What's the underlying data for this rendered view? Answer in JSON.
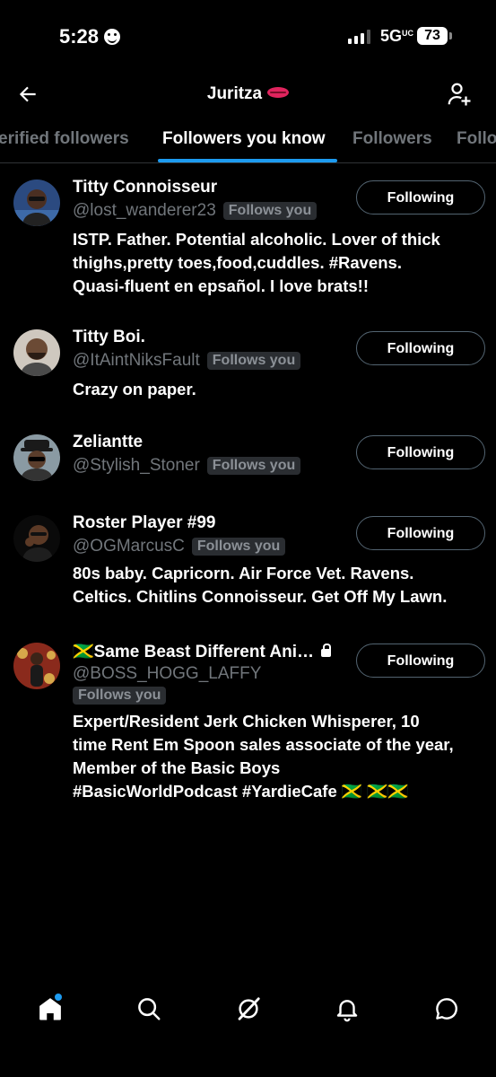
{
  "status_bar": {
    "time": "5:28",
    "network": "5G",
    "network_sup": "UC",
    "battery": "73"
  },
  "header": {
    "title": "Juritza"
  },
  "tabs": [
    {
      "label": "erified followers"
    },
    {
      "label": "Followers you know"
    },
    {
      "label": "Followers"
    },
    {
      "label": "Follo"
    }
  ],
  "users": [
    {
      "name": "Titty Connoisseur",
      "handle": "@lost_wanderer23",
      "badge": "Follows you",
      "button": "Following",
      "bio_lines": [
        "ISTP. Father. Potential alcoholic. Lover of thick",
        "thighs,pretty toes,food,cuddles. #Ravens.",
        "Quasi-fluent en epsañol. I love brats!!"
      ]
    },
    {
      "name": "Titty Boi.",
      "handle": "@ItAintNiksFault",
      "badge": "Follows you",
      "button": "Following",
      "bio_lines": [
        "Crazy on paper."
      ]
    },
    {
      "name": "Zeliantte",
      "handle": "@Stylish_Stoner",
      "badge": "Follows you",
      "button": "Following",
      "bio_lines": []
    },
    {
      "name": "Roster Player #99",
      "handle": "@OGMarcusC",
      "badge": "Follows you",
      "button": "Following",
      "bio_lines": [
        "80s baby. Capricorn. Air Force Vet. Ravens.",
        "Celtics. Chitlins Connoisseur. Get Off My Lawn."
      ]
    },
    {
      "name": "Same Beast Different Ani…",
      "name_flag": "🇯🇲",
      "handle": "@BOSS_HOGG_LAFFY",
      "badge": "Follows you",
      "button": "Following",
      "bio_lines": [
        "Expert/Resident Jerk Chicken Whisperer, 10",
        "time Rent Em Spoon sales associate of the year,",
        "Member of the Basic Boys",
        "#BasicWorldPodcast #YardieCafe 🇯🇲 🇯🇲🇯🇲"
      ]
    }
  ],
  "icons": {
    "back": "arrow-left-icon",
    "add_user": "add-user-icon",
    "home": "home-icon",
    "search": "search-icon",
    "grok": "grok-icon",
    "notifications": "bell-icon",
    "messages": "chat-bubble-icon"
  },
  "colors": {
    "accent": "#1d9bf0",
    "muted": "#71767b",
    "background": "#000000"
  }
}
